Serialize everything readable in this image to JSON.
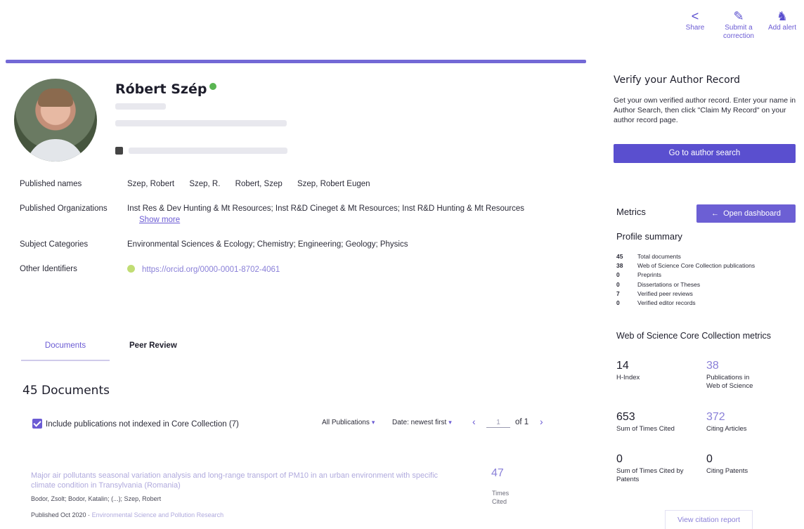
{
  "top_actions": [
    {
      "icon": "share-icon",
      "label": "Share"
    },
    {
      "icon": "pencil-icon",
      "label": "Submit a correction"
    },
    {
      "icon": "bell-icon",
      "label": "Add alert"
    }
  ],
  "author": {
    "name": "Róbert Szép"
  },
  "info": {
    "published_names_label": "Published names",
    "published_names": [
      "Szep, Robert",
      "Szep, R.",
      "Robert, Szep",
      "Szep, Robert Eugen"
    ],
    "orgs_label": "Published Organizations",
    "orgs_value": "Inst Res & Dev Hunting & Mt Resources; Inst R&D Cineget & Mt Resources; Inst R&D Hunting & Mt Resources",
    "show_more": "Show more",
    "subjects_label": "Subject Categories",
    "subjects_value": "Environmental Sciences & Ecology; Chemistry; Engineering; Geology; Physics",
    "ids_label": "Other Identifiers",
    "orcid": "https://orcid.org/0000-0001-8702-4061"
  },
  "tabs": {
    "documents": "Documents",
    "peer_review": "Peer Review"
  },
  "documents": {
    "heading": "45 Documents",
    "include_label": "Include publications not indexed in Core Collection (7)",
    "filter": "All Publications",
    "sort": "Date: newest first",
    "page_of": "of 1",
    "page_value": "1"
  },
  "record": {
    "title": "Major air pollutants seasonal variation analysis and long-range transport of PM10 in an urban environment with specific climate condition in Transylvania (Romania)",
    "authors": "Bodor, Zsolt; Bodor, Katalin; (...); Szep, Robert",
    "published": "Published Oct 2020 ·",
    "journal": "Environmental Science and Pollution Research",
    "times_cited": "47",
    "times_cited_label": "Times Cited"
  },
  "verify": {
    "title": "Verify your Author Record",
    "text": "Get your own verified author record. Enter your name in Author Search, then click \"Claim My Record\" on your author record page.",
    "button": "Go to author search"
  },
  "metrics": {
    "title": "Metrics",
    "dashboard_button": "Open dashboard",
    "profile_summary": "Profile summary",
    "summary": [
      {
        "n": "45",
        "label": "Total documents"
      },
      {
        "n": "38",
        "label": "Web of Science Core Collection publications"
      },
      {
        "n": "0",
        "label": "Preprints"
      },
      {
        "n": "0",
        "label": "Dissertations or Theses"
      },
      {
        "n": "7",
        "label": "Verified peer reviews"
      },
      {
        "n": "0",
        "label": "Verified editor records"
      }
    ],
    "wos_title": "Web of Science Core Collection metrics",
    "h_index": {
      "value": "14",
      "label": "H-Index"
    },
    "pubs_wos": {
      "value": "38",
      "label": "Publications in Web of Science"
    },
    "times_cited": {
      "value": "653",
      "label": "Sum of Times Cited"
    },
    "citing_articles": {
      "value": "372",
      "label": "Citing Articles"
    },
    "cited_by_patents": {
      "value": "0",
      "label": "Sum of Times Cited by Patents"
    },
    "citing_patents": {
      "value": "0",
      "label": "Citing Patents"
    },
    "view_report": "View citation report"
  }
}
